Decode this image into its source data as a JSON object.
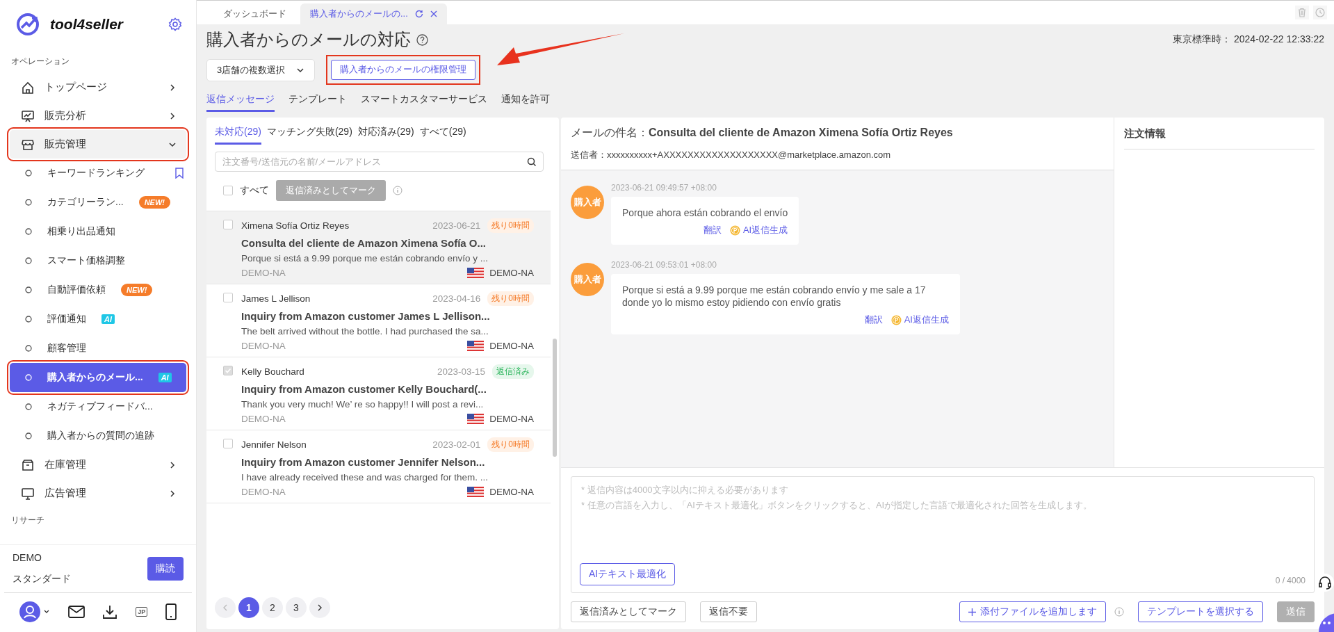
{
  "sidebar": {
    "brand": "tool4seller",
    "sections": [
      {
        "label": "オペレーション",
        "items": [
          {
            "label": "トップページ",
            "expanded": false,
            "highlighted": false
          },
          {
            "label": "販売分析",
            "expanded": false,
            "highlighted": false
          },
          {
            "label": "販売管理",
            "expanded": true,
            "highlighted": true,
            "children": [
              {
                "label": "キーワードランキング",
                "selected": false,
                "highlighted": false,
                "bookmarked": true
              },
              {
                "label": "カテゴリーラン...",
                "selected": false,
                "highlighted": false,
                "badge": {
                  "text": "NEW!",
                  "kind": "new"
                }
              },
              {
                "label": "相乗り出品通知",
                "selected": false,
                "highlighted": false
              },
              {
                "label": "スマート価格調整",
                "selected": false,
                "highlighted": false
              },
              {
                "label": "自動評価依頼",
                "selected": false,
                "highlighted": false,
                "badge": {
                  "text": "NEW!",
                  "kind": "new"
                }
              },
              {
                "label": "評価通知",
                "selected": false,
                "highlighted": false,
                "badge": {
                  "text": "AI",
                  "kind": "ai"
                }
              },
              {
                "label": "顧客管理",
                "selected": false,
                "highlighted": false
              },
              {
                "label": "購入者からのメール...",
                "selected": true,
                "highlighted": true,
                "badge": {
                  "text": "AI",
                  "kind": "ai"
                }
              },
              {
                "label": "ネガティブフィードバ...",
                "selected": false,
                "highlighted": false
              },
              {
                "label": "購入者からの質問の追跡",
                "selected": false,
                "highlighted": false
              }
            ]
          },
          {
            "label": "在庫管理",
            "expanded": false,
            "highlighted": false
          },
          {
            "label": "広告管理",
            "expanded": false,
            "highlighted": false
          }
        ]
      },
      {
        "label": "リサーチ"
      }
    ],
    "account": {
      "name": "DEMO",
      "plan": "スタンダード",
      "subscribe": "購読"
    },
    "language": "JP"
  },
  "tabs": [
    {
      "label": "ダッシュボード",
      "selected": false
    },
    {
      "label": "購入者からのメールの...",
      "selected": true
    }
  ],
  "header": {
    "title": "購入者からのメールの対応",
    "time": "東京標準時： 2024-02-22 12:33:22",
    "store_select": {
      "value": "3店舗の複数選択"
    },
    "permissions_button": {
      "label": "購入者からのメールの権限管理",
      "highlighted": true
    },
    "subtabs": [
      {
        "label": "返信メッセージ",
        "selected": true
      },
      {
        "label": "テンプレート",
        "selected": false
      },
      {
        "label": "スマートカスタマーサービス",
        "selected": false
      },
      {
        "label": "通知を許可",
        "selected": false
      }
    ]
  },
  "mail_list": {
    "filters": [
      {
        "label": "未対応(29)",
        "selected": true
      },
      {
        "label": "マッチング失敗(29)",
        "selected": false
      },
      {
        "label": "対応済み(29)",
        "selected": false
      },
      {
        "label": "すべて(29)",
        "selected": false
      }
    ],
    "search": {
      "placeholder": "注文番号/送信元の名前/メールアドレス"
    },
    "select_all": {
      "label": "すべて",
      "checked": false
    },
    "mark_button": {
      "label": "返信済みとしてマーク",
      "disabled": true
    },
    "messages": [
      {
        "name": "Ximena Sofía Ortiz Reyes",
        "date": "2023-06-21",
        "status": {
          "text": "残り0時間",
          "kind": "remaining"
        },
        "subject": "Consulta del cliente de Amazon Ximena Sofía O...",
        "preview": "Porque si está a 9.99 porque me están cobrando envío y ...",
        "store": "DEMO-NA",
        "marketplace": "DEMO-NA",
        "checked": false,
        "selected": true
      },
      {
        "name": "James L Jellison",
        "date": "2023-04-16",
        "status": {
          "text": "残り0時間",
          "kind": "remaining"
        },
        "subject": "Inquiry from Amazon customer James L Jellison...",
        "preview": "The belt arrived without the bottle. I had purchased the sa...",
        "store": "DEMO-NA",
        "marketplace": "DEMO-NA",
        "checked": false,
        "selected": false
      },
      {
        "name": "Kelly Bouchard",
        "date": "2023-03-15",
        "status": {
          "text": "返信済み",
          "kind": "replied"
        },
        "subject": "Inquiry from Amazon customer Kelly Bouchard(...",
        "preview": "Thank you very much! We’ re so happy!! I will post a revi...",
        "store": "DEMO-NA",
        "marketplace": "DEMO-NA",
        "checked": true,
        "selected": false
      },
      {
        "name": "Jennifer Nelson",
        "date": "2023-02-01",
        "status": {
          "text": "残り0時間",
          "kind": "remaining"
        },
        "subject": "Inquiry from Amazon customer Jennifer Nelson...",
        "preview": "I have already received these and was charged for them. ...",
        "store": "DEMO-NA",
        "marketplace": "DEMO-NA",
        "checked": false,
        "selected": false
      }
    ],
    "pages": [
      {
        "label": "1",
        "selected": true
      },
      {
        "label": "2",
        "selected": false
      },
      {
        "label": "3",
        "selected": false
      }
    ]
  },
  "thread": {
    "subject_label": "メールの件名：",
    "subject": "Consulta del cliente de Amazon Ximena Sofía Ortiz Reyes",
    "sender_label": "送信者：",
    "sender": "xxxxxxxxxx+AXXXXXXXXXXXXXXXXXXX@marketplace.amazon.com",
    "messages": [
      {
        "author": "購入者",
        "time": "2023-06-21 09:49:57 +08:00",
        "text": "Porque ahora están cobrando el envío",
        "translate": "翻訳",
        "ai_reply": "AI返信生成"
      },
      {
        "author": "購入者",
        "time": "2023-06-21 09:53:01 +08:00",
        "text": "Porque si está a 9.99 porque me están cobrando envío y me sale a 17 donde yo lo mismo estoy pidiendo con envío gratis",
        "translate": "翻訳",
        "ai_reply": "AI返信生成"
      }
    ]
  },
  "order_info": {
    "title": "注文情報"
  },
  "composer": {
    "placeholder": "* 返信内容は4000文字以内に抑える必要があります\n* 任意の言語を入力し、「AIテキスト最適化」ボタンをクリックすると、AIが指定した言語で最適化された回答を生成します。",
    "optimize": "AIテキスト最適化",
    "counter": "0 / 4000",
    "buttons": [
      {
        "label": "返信済みとしてマーク",
        "kind": "plain"
      },
      {
        "label": "返信不要",
        "kind": "plain"
      },
      {
        "label": "添付ファイルを追加します",
        "kind": "attach"
      },
      {
        "label": "テンプレートを選択する",
        "kind": "outline"
      },
      {
        "label": "送信",
        "kind": "primary",
        "disabled": true
      }
    ]
  }
}
